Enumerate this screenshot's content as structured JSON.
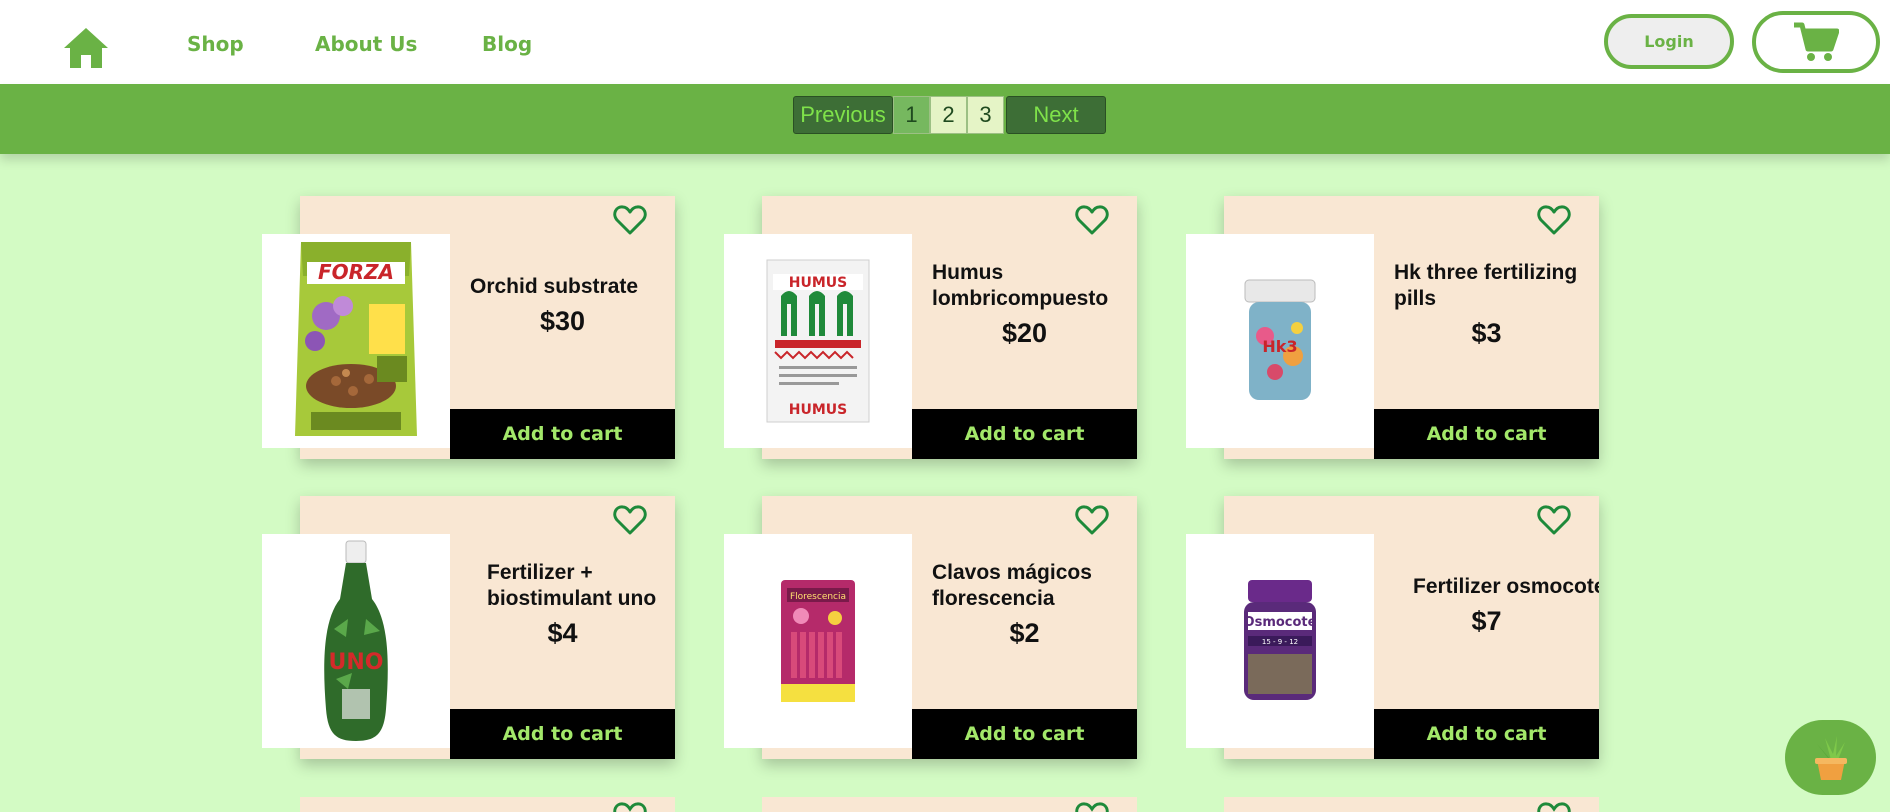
{
  "nav": {
    "home_icon": "home-icon",
    "links": [
      "Shop",
      "About Us",
      "Blog"
    ],
    "login_label": "Login",
    "cart_icon": "cart-icon"
  },
  "pagination": {
    "previous": "Previous",
    "pages": [
      "1",
      "2",
      "3"
    ],
    "current_page": "1",
    "next": "Next"
  },
  "products": [
    {
      "name": "Orchid substrate",
      "price": "$30",
      "add_label": "Add to cart",
      "image": "forza-orchid-bag"
    },
    {
      "name": "Humus lombricompuesto",
      "price": "$20",
      "add_label": "Add to cart",
      "image": "humus-bag"
    },
    {
      "name": "Hk three fertilizing pills",
      "price": "$3",
      "add_label": "Add to cart",
      "image": "hk3-jar"
    },
    {
      "name": "Fertilizer + biostimulant uno",
      "price": "$4",
      "add_label": "Add to cart",
      "image": "uno-bottle"
    },
    {
      "name": "Clavos mágicos florescencia",
      "price": "$2",
      "add_label": "Add to cart",
      "image": "florescencia-pack"
    },
    {
      "name": "Fertilizer osmocote",
      "price": "$7",
      "add_label": "Add to cart",
      "image": "osmocote-jar"
    }
  ],
  "colors": {
    "brand_green": "#6ab245",
    "page_background": "#d3fbc4",
    "card_background": "#f9e7d3",
    "add_to_cart_text": "#a3e86a",
    "heart_outline": "#1e8a3a"
  },
  "fab_icon": "potted-plant-icon"
}
